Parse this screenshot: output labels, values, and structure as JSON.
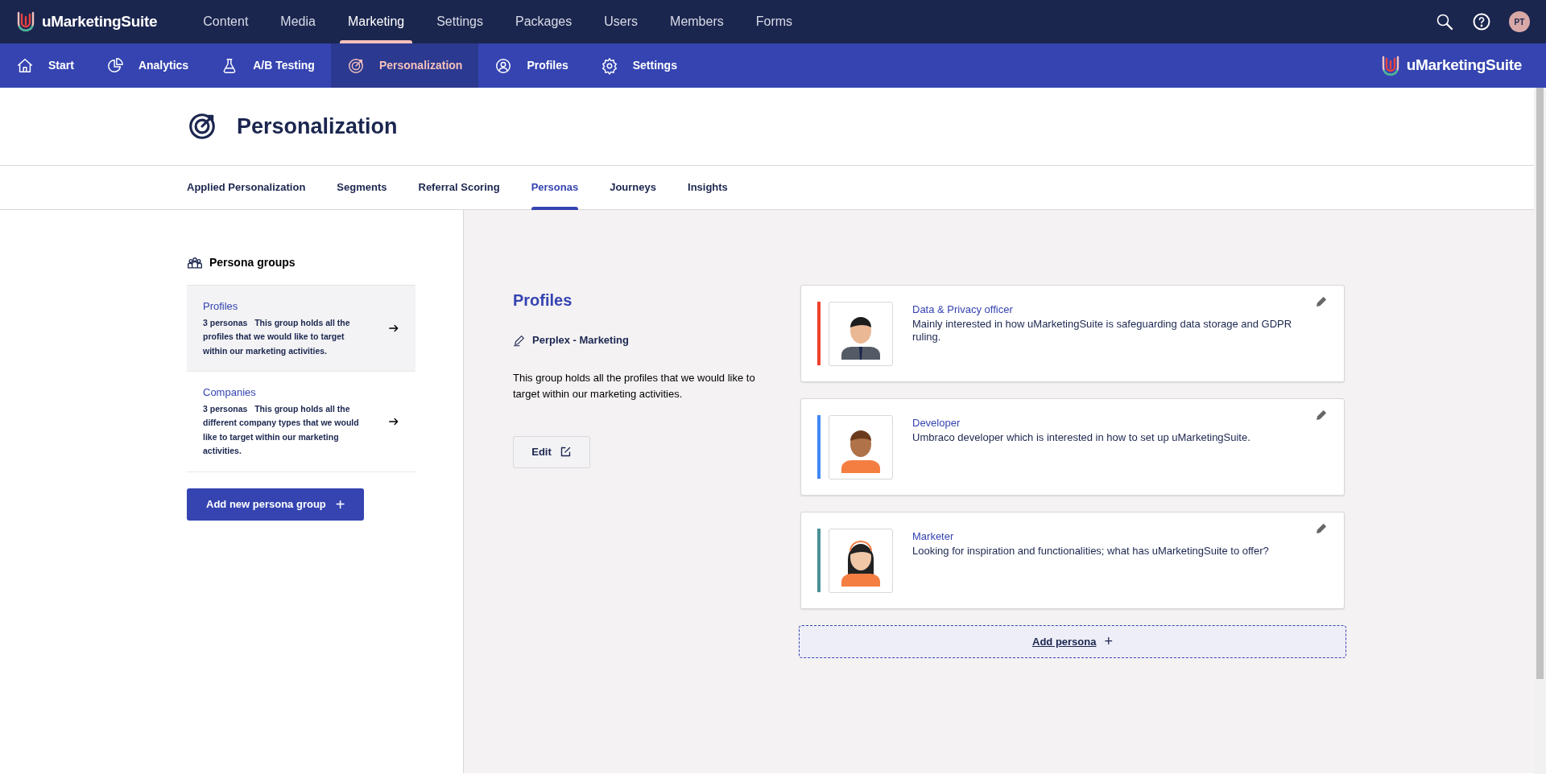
{
  "top_nav": {
    "brand": "uMarketingSuite",
    "items": [
      {
        "label": "Content",
        "selected": false
      },
      {
        "label": "Media",
        "selected": false
      },
      {
        "label": "Marketing",
        "selected": true
      },
      {
        "label": "Settings",
        "selected": false
      },
      {
        "label": "Packages",
        "selected": false
      },
      {
        "label": "Users",
        "selected": false
      },
      {
        "label": "Members",
        "selected": false
      },
      {
        "label": "Forms",
        "selected": false
      }
    ],
    "avatar_initials": "PT"
  },
  "sub_nav": {
    "items": [
      {
        "label": "Start",
        "selected": false
      },
      {
        "label": "Analytics",
        "selected": false
      },
      {
        "label": "A/B Testing",
        "selected": false
      },
      {
        "label": "Personalization",
        "selected": true
      },
      {
        "label": "Profiles",
        "selected": false
      },
      {
        "label": "Settings",
        "selected": false
      }
    ],
    "brand": "uMarketingSuite"
  },
  "page": {
    "title": "Personalization"
  },
  "tabs": [
    {
      "label": "Applied Personalization",
      "selected": false
    },
    {
      "label": "Segments",
      "selected": false
    },
    {
      "label": "Referral Scoring",
      "selected": false
    },
    {
      "label": "Personas",
      "selected": true
    },
    {
      "label": "Journeys",
      "selected": false
    },
    {
      "label": "Insights",
      "selected": false
    }
  ],
  "sidebar": {
    "title": "Persona groups",
    "groups": [
      {
        "name": "Profiles",
        "count": "3 personas",
        "description": "This group holds all the profiles that we would like to target within our marketing activities.",
        "selected": true
      },
      {
        "name": "Companies",
        "count": "3 personas",
        "description": "This group holds all the different company types that we would like to target within our marketing activities.",
        "selected": false
      }
    ],
    "add_button": "Add new persona group",
    "add_button_icon": "+"
  },
  "detail": {
    "title": "Profiles",
    "owner": "Perplex - Marketing",
    "description": "This group holds all the profiles that we would like to target within our marketing activities.",
    "edit_button": "Edit"
  },
  "personas": [
    {
      "name": "Data & Privacy officer",
      "description": "Mainly interested in how uMarketingSuite is safeguarding data storage and GDPR ruling.",
      "color": "#f0412b"
    },
    {
      "name": "Developer",
      "description": "Umbraco developer which is interested in how to set up uMarketingSuite.",
      "color": "#3f88f5"
    },
    {
      "name": "Marketer",
      "description": "Looking for inspiration and functionalities; what has uMarketingSuite to offer?",
      "color": "#4b9196"
    }
  ],
  "add_persona": {
    "label": "Add persona",
    "icon": "+"
  }
}
